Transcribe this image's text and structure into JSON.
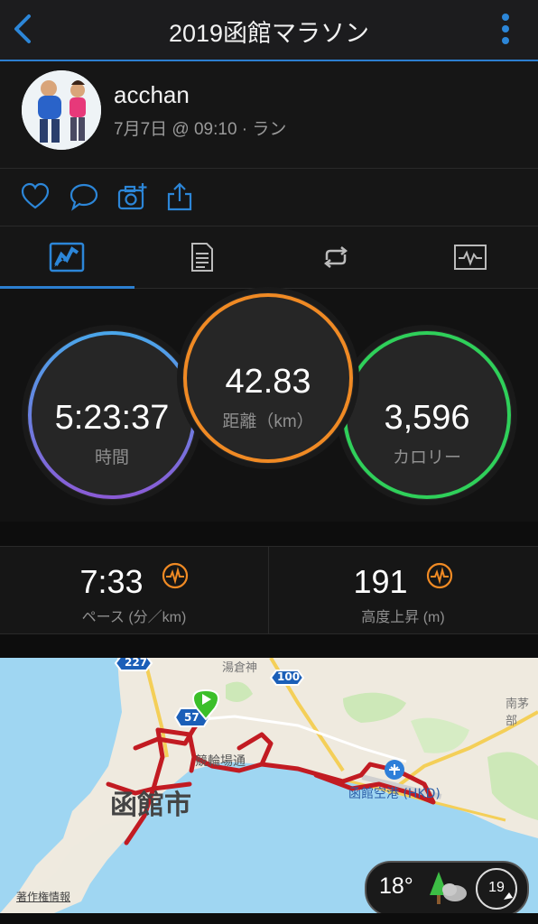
{
  "header": {
    "title": "2019函館マラソン"
  },
  "profile": {
    "name": "acchan",
    "meta": "7月7日 @ 09:10 · ラン"
  },
  "stats_circles": [
    {
      "value": "5:23:37",
      "label": "時間"
    },
    {
      "value": "42.83",
      "label": "距離（km）"
    },
    {
      "value": "3,596",
      "label": "カロリー"
    }
  ],
  "stats_row": [
    {
      "value": "7:33",
      "label": "ペース (分／km)"
    },
    {
      "value": "191",
      "label": "高度上昇 (m)"
    }
  ],
  "map": {
    "route_labels": [
      "227",
      "100",
      "57"
    ],
    "place_city": "函館市",
    "place_bike": "競輪場通",
    "place_airport": "函館空港 (HKD)",
    "place_north1": "湯倉神",
    "place_east": "南茅部",
    "copyright": "著作権情報"
  },
  "weather": {
    "temp": "18°",
    "wind": "19"
  },
  "colors": {
    "accent": "#2c7fd0",
    "time": "#5b8ee0",
    "distance": "#f08a24",
    "calories": "#2fd05a",
    "route": "#c21b22"
  }
}
